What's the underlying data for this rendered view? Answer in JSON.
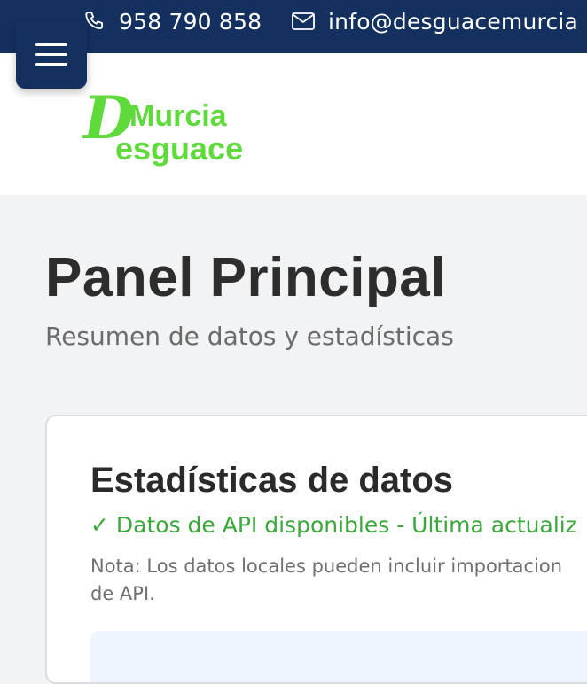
{
  "topbar": {
    "phone": "958 790 858",
    "email": "info@desguacemurcia",
    "icons": {
      "phone": "phone-icon",
      "email": "mail-icon"
    }
  },
  "header": {
    "menu_icon": "hamburger-menu-icon",
    "logo": {
      "word1": "Murcia",
      "word2": "esguace",
      "letter": "D",
      "color": "#5edb3a"
    }
  },
  "main": {
    "title": "Panel Principal",
    "subtitle": "Resumen de datos y estadísticas"
  },
  "stats_card": {
    "title": "Estadísticas de datos",
    "status_check": "✓",
    "status": "Datos de API disponibles - Última actualiz",
    "note_line1": "Nota: Los datos locales pueden incluir importacion",
    "note_line2": "de API."
  },
  "colors": {
    "nav_bg": "#14305f",
    "page_bg": "#f2f3f5",
    "success": "#3aa83a",
    "info_bg": "#eef5fe"
  }
}
